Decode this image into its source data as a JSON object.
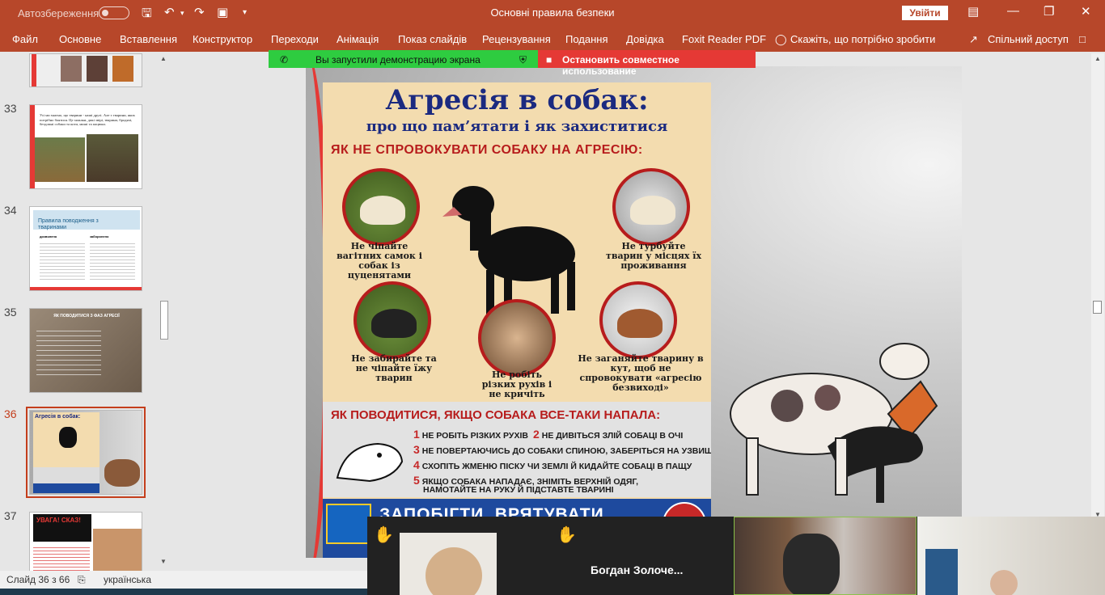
{
  "titlebar": {
    "autosave_label": "Автозбереження",
    "doc_title": "Основні правила безпеки",
    "login_label": "Увійти"
  },
  "menu": {
    "items": [
      "Файл",
      "Основне",
      "Вставлення",
      "Конструктор",
      "Переходи",
      "Анімація",
      "Показ слайдів",
      "Рецензування",
      "Подання",
      "Довідка",
      "Foxit Reader PDF",
      "Скажіть, що потрібно зробити"
    ],
    "share_label": "Спільний доступ"
  },
  "slides": {
    "numbers": [
      "33",
      "34",
      "35",
      "36",
      "37"
    ],
    "thumb33_text": "Усі ми знаємо, що тварини - наші друзі. Але є тварини, яких потрібно боятися. Це хижаки, дикі звірі, тварини, бродячі, бездомні собаки та коти, миші та пацюки.",
    "thumb34_title": "Правила поводження з тваринами",
    "thumb34_col1": "дозволено",
    "thumb34_col2": "заборонено",
    "thumb35_title": "ЯК ПОВОДИТИСЯ З ФАЗ АГРЕСІЇ",
    "thumb36_title": "Агресія в собак:",
    "thumb37_title": "УВАГА! СКАЗ!"
  },
  "share": {
    "green_label": "Вы запустили демонстрацию экрана",
    "red_label": "Остановить совместное использование"
  },
  "poster": {
    "title": "Агресія в собак:",
    "subtitle": "про що пам’ятати і як захиститися",
    "heading1": "ЯК НЕ СПРОВОКУВАТИ СОБАКУ НА АГРЕСІЮ:",
    "cap1": "Не чіпайте вагітних самок і собак із цуценятами",
    "cap2": "Не турбуйте тварин у місцях їх проживання",
    "cap3": "Не забирайте та не чіпайте їжу тварин",
    "cap4": "Не робіть різких рухів і не кричіть",
    "cap5": "Не заганяйте тварину в кут, щоб не спровокувати «агресію безвиході»",
    "heading2": "ЯК ПОВОДИТИСЯ, ЯКЩО СОБАКА ВСЕ-ТАКИ НАПАЛА:",
    "rules": [
      {
        "n": "1",
        "t": "НЕ РОБІТЬ РІЗКИХ РУХІВ"
      },
      {
        "n": "2",
        "t": "НЕ ДИВІТЬСЯ ЗЛІЙ СОБАЦІ В ОЧІ"
      },
      {
        "n": "3",
        "t": "НЕ ПОВЕРТАЮЧИСЬ ДО СОБАКИ СПИНОЮ, ЗАБЕРІТЬСЯ НА УЗВИШШЯ"
      },
      {
        "n": "4",
        "t": "СХОПІТЬ ЖМЕНЮ ПІСКУ ЧИ ЗЕМЛІ Й КИДАЙТЕ СОБАЦІ В ПАЩУ"
      },
      {
        "n": "5",
        "t": "ЯКЩО СОБАКА НАПАДАЄ, ЗНІМІТЬ ВЕРХНІЙ ОДЯГ,"
      },
      {
        "n": "",
        "t": "НАМОТАЙТЕ НА РУКУ Й ПІДСТАВТЕ ТВАРИНІ"
      }
    ],
    "banner": "ЗАПОБІГТИ, ВРЯТУВАТИ, ДОПОМОГТИ"
  },
  "status": {
    "slide_info": "Слайд 36 з 66",
    "language": "українська"
  },
  "videos": {
    "participant_name": "Богдан  Золоче..."
  }
}
